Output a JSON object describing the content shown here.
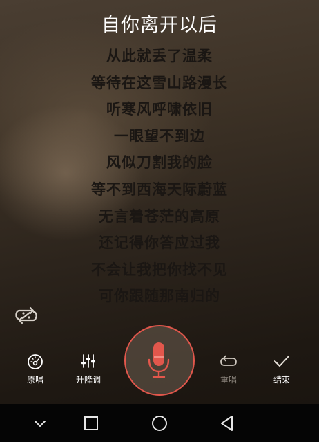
{
  "song": {
    "title": "自你离开以后"
  },
  "lyrics": [
    "从此就丢了温柔",
    "等待在这雪山路漫长",
    "听寒风呼啸依旧",
    "一眼望不到边",
    "风似刀割我的脸",
    "等不到西海天际蔚蓝",
    "无言着苍茫的高原",
    "还记得你答应过我",
    "不会让我把你找不见",
    "可你跟随那南归的"
  ],
  "controls": {
    "loop_icon": "repeat-shuffle-icon",
    "original_vocal": {
      "label": "原唱",
      "icon": "speedometer-icon"
    },
    "pitch": {
      "label": "升降调",
      "icon": "equalizer-sliders-icon"
    },
    "mic": {
      "icon": "microphone-icon",
      "accent": "#e2574c"
    },
    "restart": {
      "label": "重唱",
      "icon": "repeat-icon",
      "enabled": false
    },
    "finish": {
      "label": "结束",
      "icon": "checkmark-icon"
    }
  },
  "nav": {
    "back": "triangle-back-icon",
    "home": "circle-home-icon",
    "recents": "square-recents-icon",
    "notifications": "chevron-down-icon"
  }
}
